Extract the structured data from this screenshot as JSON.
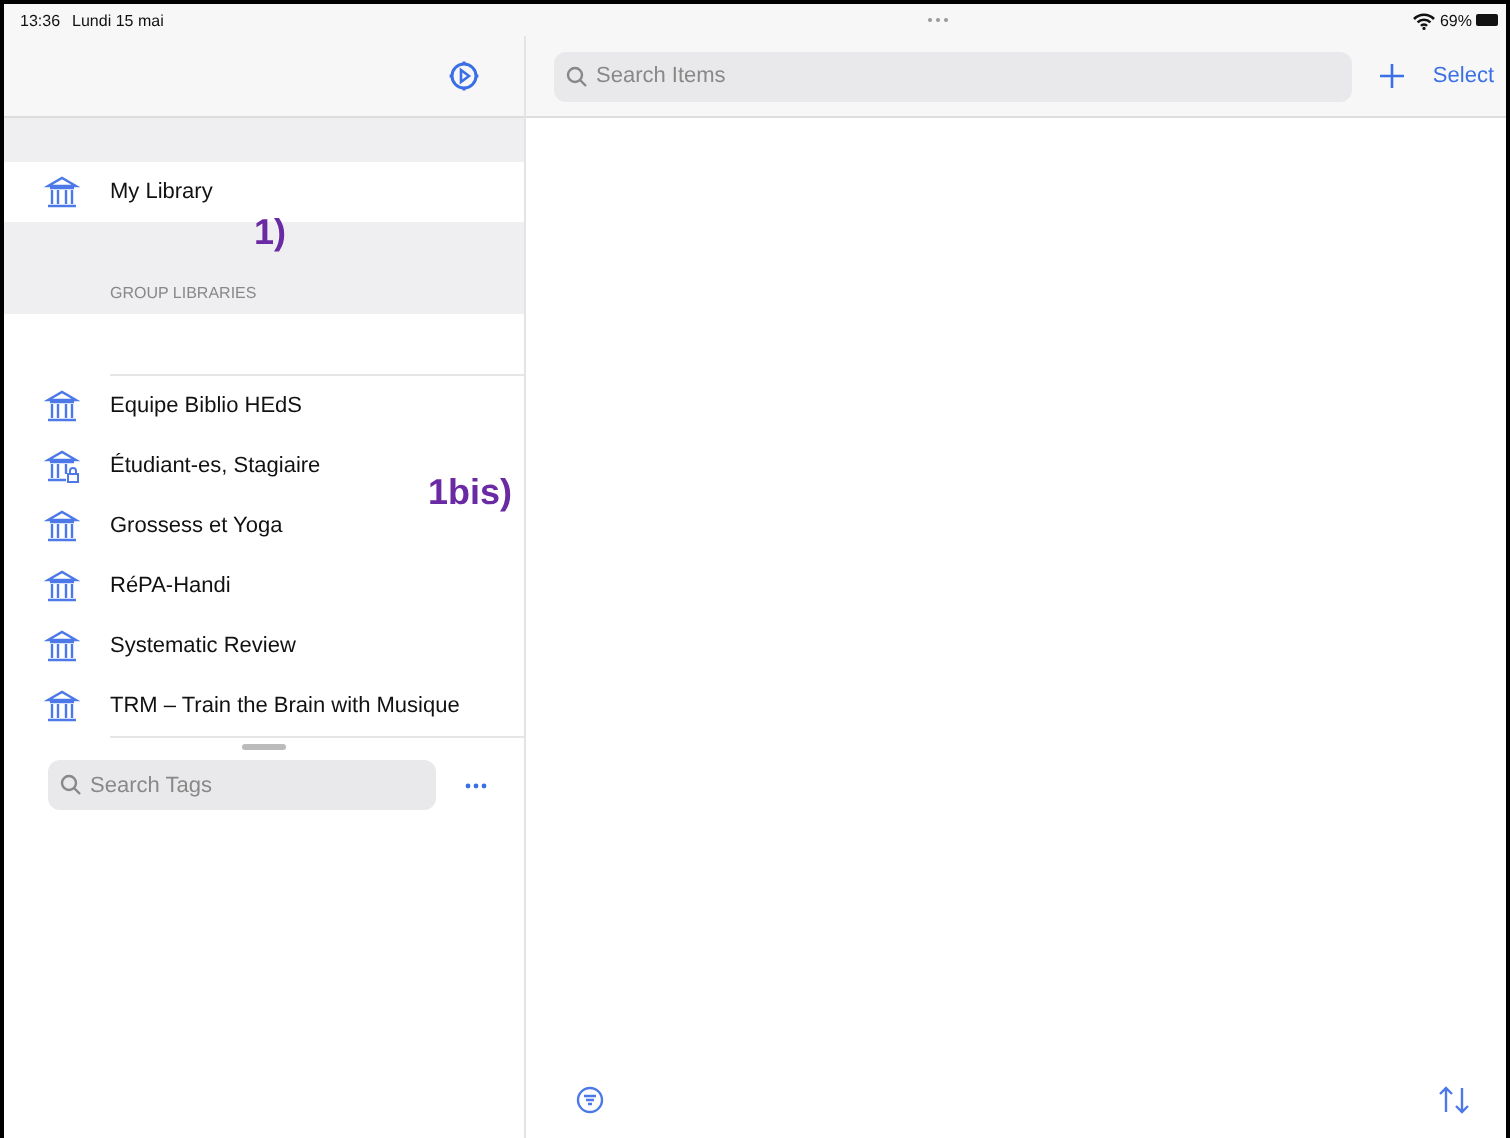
{
  "status_bar": {
    "time": "13:36",
    "date": "Lundi 15 mai",
    "battery": "69%"
  },
  "sidebar": {
    "my_library": {
      "label": "My Library",
      "annotation": "1)"
    },
    "group_header": "GROUP LIBRARIES",
    "groups": [
      {
        "label": "Equipe Biblio HEdS",
        "locked": false
      },
      {
        "label": "Étudiant-es, Stagiaire",
        "locked": true
      },
      {
        "label": "Grossess et Yoga",
        "locked": false
      },
      {
        "label": "RéPA-Handi",
        "locked": false
      },
      {
        "label": "Systematic Review",
        "locked": false
      },
      {
        "label": "TRM – Train the Brain with Musique",
        "locked": false
      }
    ],
    "groups_annotation": "1bis)",
    "tag_search": {
      "placeholder": "Search Tags"
    }
  },
  "main": {
    "search": {
      "placeholder": "Search Items"
    },
    "select_button": "Select"
  }
}
